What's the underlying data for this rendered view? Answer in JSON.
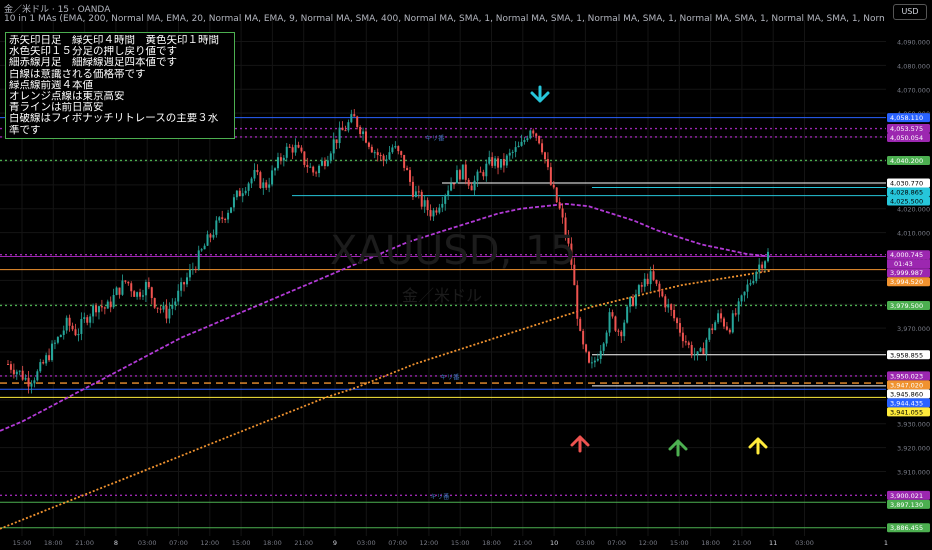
{
  "header": {
    "symbol_line": "金／米ドル · 15 · OANDA",
    "indicator_line": "10 in 1 MAs (EMA, 200, Normal MA, EMA, 20, Normal MA, EMA, 9, Normal MA, SMA, 400, Normal MA, SMA, 1, Normal MA, SMA, 1, Normal MA, SMA, 1, Normal MA, SMA, 1, Normal MA, SMA, 1, Normal MA, SMA, 1, Norm",
    "currency_button": "USD"
  },
  "note": {
    "lines": [
      "赤矢印日足　緑矢印４時間　黄色矢印１時間",
      "水色矢印１５分足の押し戻り値です",
      "細赤線月足　細緑線週足四本値です",
      "白線は意識される価格帯です",
      "緑点線前週４本値",
      "オレンジ点線は東京高安",
      "青ラインは前日高安",
      "白破線はフィボナッチリトレースの主要３水",
      "準です"
    ]
  },
  "watermark": {
    "symbol": "XAUUSD, 15",
    "name": "金／米ドル"
  },
  "chart_data": {
    "type": "candlestick",
    "ylim": [
      3883,
      4099
    ],
    "y_ticks": [
      3910,
      3920,
      3930,
      3940,
      3950,
      3960,
      3970,
      3980,
      3990,
      4000,
      4010,
      4020,
      4030,
      4040,
      4050,
      4060,
      4070,
      4080,
      4090
    ],
    "x_ticks": [
      "15:00",
      "18:00",
      "21:00",
      "8",
      "03:00",
      "07:00",
      "12:00",
      "15:00",
      "18:00",
      "21:00",
      "9",
      "03:00",
      "07:00",
      "12:00",
      "15:00",
      "18:00",
      "21:00",
      "10",
      "03:00",
      "07:00",
      "12:00",
      "15:00",
      "18:00",
      "21:00",
      "11",
      "03:00"
    ],
    "x_tick_last": "1",
    "price_path": [
      3955,
      3952,
      3948,
      3951,
      3958,
      3965,
      3972,
      3968,
      3975,
      3980,
      3978,
      3985,
      3990,
      3984,
      3988,
      3980,
      3976,
      3982,
      3990,
      3997,
      4005,
      4012,
      4018,
      4024,
      4030,
      4034,
      4029,
      4036,
      4044,
      4046,
      4040,
      4035,
      4040,
      4048,
      4053,
      4058,
      4052,
      4045,
      4040,
      4046,
      4040,
      4028,
      4022,
      4018,
      4025,
      4032,
      4036,
      4030,
      4035,
      4040,
      4038,
      4043,
      4046,
      4055,
      4048,
      4030,
      4018,
      4000,
      3965,
      3952,
      3962,
      3975,
      3968,
      3980,
      3986,
      3992,
      3985,
      3978,
      3970,
      3962,
      3957,
      3968,
      3975,
      3970,
      3978,
      3988,
      3996,
      4001
    ],
    "moving_averages": [
      {
        "name": "EMA 200",
        "color": "#b23ad6",
        "style": "dashed",
        "values": [
          3927,
          3931,
          3936,
          3941,
          3946,
          3951,
          3956,
          3961,
          3966,
          3970,
          3974,
          3978,
          3982,
          3986,
          3990,
          3994,
          3998,
          4002,
          4006,
          4009,
          4012,
          4015,
          4018,
          4020,
          4021,
          4022,
          4021,
          4018,
          4015,
          4011,
          4008,
          4005,
          4003,
          4001,
          4000
        ]
      },
      {
        "name": "SMA 400",
        "color": "#f0922f",
        "style": "dotted",
        "values": [
          3886,
          3891,
          3896,
          3901,
          3906,
          3911,
          3916,
          3921,
          3926,
          3931,
          3936,
          3941,
          3945,
          3950,
          3955,
          3959,
          3963,
          3967,
          3971,
          3975,
          3979,
          3982,
          3985,
          3988,
          3990,
          3992,
          3994
        ]
      }
    ],
    "horizontal_levels": [
      {
        "price": 4058.11,
        "label": "4,058.110",
        "color": "#2962ff",
        "style": "solid"
      },
      {
        "price": 4053.575,
        "label": "4,053.575",
        "color": "#9c27b0",
        "style": "dotted"
      },
      {
        "price": 4050.054,
        "label": "4,050.054",
        "color": "#9c27b0",
        "style": "dotted"
      },
      {
        "price": 4040.2,
        "label": "4,040.200",
        "color": "#4caf50",
        "style": "dotted"
      },
      {
        "price": 4030.77,
        "label": "4,030.770",
        "color": "#ffffff",
        "style": "solid"
      },
      {
        "price": 4028.865,
        "label": "4,028.865",
        "color": "#26c6da",
        "style": "solid"
      },
      {
        "price": 4025.5,
        "label": "4,025.500",
        "color": "#26c6da",
        "style": "solid"
      },
      {
        "price": 4000.745,
        "label": "4,000.745",
        "color": "#9c27b0",
        "style": "dotted"
      },
      {
        "price": 3999.987,
        "label": "3,999.987",
        "color": "#9c27b0",
        "style": "solid"
      },
      {
        "price": 3994.52,
        "label": "3,994.520",
        "color": "#f0922f",
        "style": "solid"
      },
      {
        "price": 3979.5,
        "label": "3,979.500",
        "color": "#4caf50",
        "style": "dotted"
      },
      {
        "price": 3958.855,
        "label": "3,958.855",
        "color": "#ffffff",
        "style": "solid"
      },
      {
        "price": 3950.023,
        "label": "3,950.023",
        "color": "#9c27b0",
        "style": "dotted"
      },
      {
        "price": 3947.02,
        "label": "3,947.020",
        "color": "#f0922f",
        "style": "dashed"
      },
      {
        "price": 3945.86,
        "label": "3,945.860",
        "color": "#ffffff",
        "style": "solid"
      },
      {
        "price": 3944.435,
        "label": "3,944.435",
        "color": "#2962ff",
        "style": "solid"
      },
      {
        "price": 3941.055,
        "label": "3,941.055",
        "color": "#ffeb3b",
        "style": "solid"
      },
      {
        "price": 3900.021,
        "label": "3,900.021",
        "color": "#9c27b0",
        "style": "dotted"
      },
      {
        "price": 3897.13,
        "label": "3,897.130",
        "color": "#4caf50",
        "style": "solid"
      },
      {
        "price": 3886.455,
        "label": "3,886.455",
        "color": "#4caf50",
        "style": "solid"
      }
    ],
    "countdown": "01:43",
    "level_tag": "キリ番",
    "arrows": [
      {
        "color": "#26c6da",
        "direction": "down"
      },
      {
        "color": "#ef5350",
        "direction": "up"
      },
      {
        "color": "#4caf50",
        "direction": "up"
      },
      {
        "color": "#ffeb3b",
        "direction": "up"
      }
    ]
  }
}
